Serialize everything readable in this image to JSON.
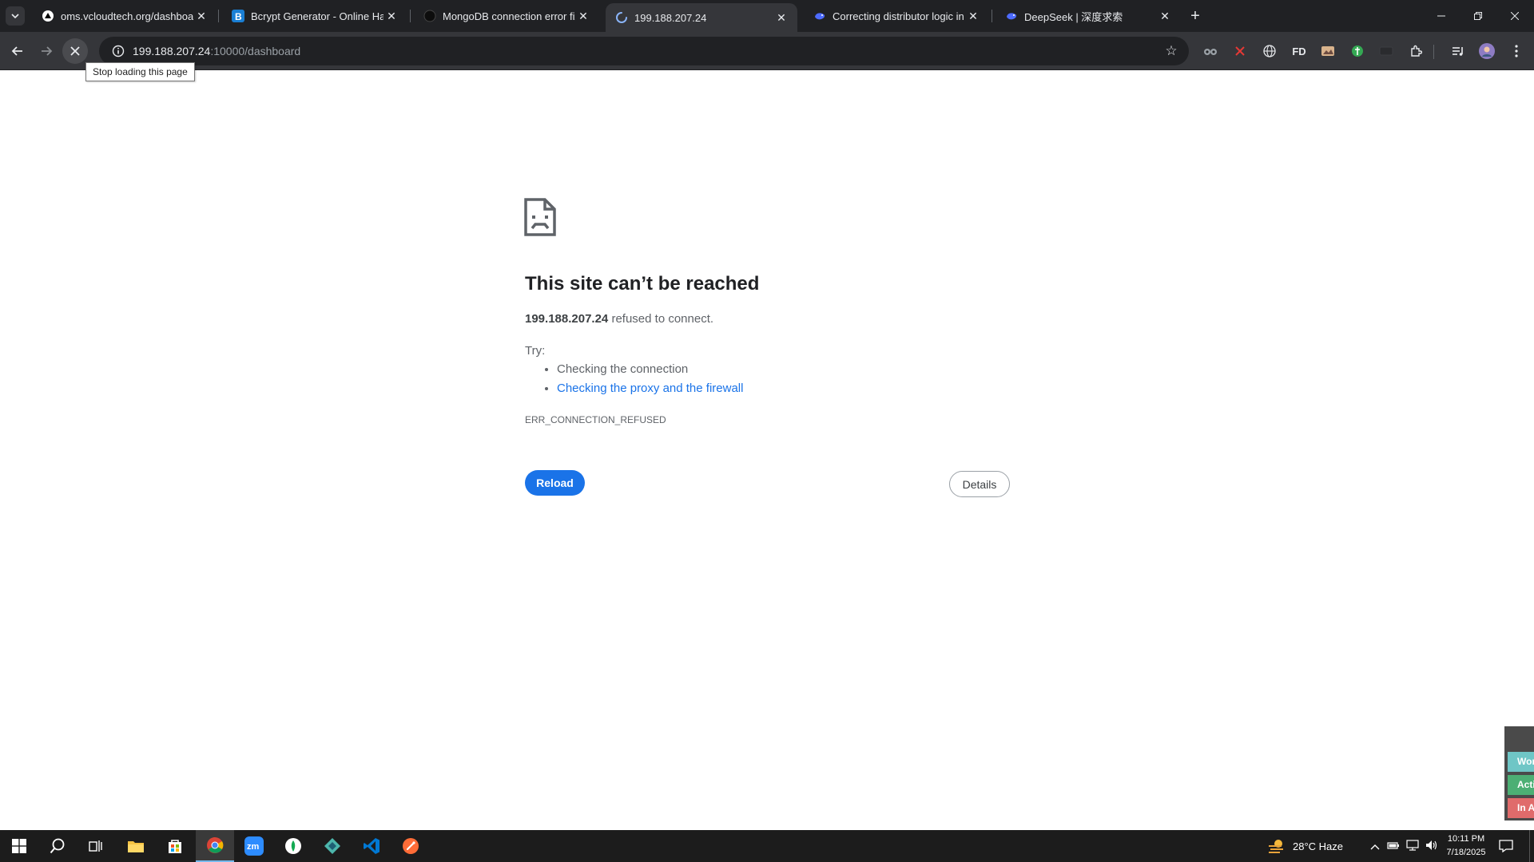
{
  "tabs": [
    {
      "title": "oms.vcloudtech.org/dashboard",
      "favicon": "triangle-logo-icon"
    },
    {
      "title": "Bcrypt Generator - Online Hash",
      "favicon": "bcrypt-b-icon"
    },
    {
      "title": "MongoDB connection error fix",
      "favicon": "openai-icon"
    },
    {
      "title": "199.188.207.24",
      "favicon": "loading-spinner-icon",
      "active": true
    },
    {
      "title": "Correcting distributor logic in Ja",
      "favicon": "deepseek-whale-icon"
    },
    {
      "title": "DeepSeek | 深度求索",
      "favicon": "deepseek-whale-icon"
    }
  ],
  "omnibox": {
    "host": "199.188.207.24",
    "path": ":10000/dashboard"
  },
  "tooltip": "Stop loading this page",
  "error": {
    "title": "This site can’t be reached",
    "host": "199.188.207.24",
    "message": " refused to connect.",
    "try_label": "Try:",
    "suggestions": [
      "Checking the connection",
      "Checking the proxy and the firewall"
    ],
    "code": "ERR_CONNECTION_REFUSED",
    "reload_label": "Reload",
    "details_label": "Details"
  },
  "extensions": {
    "fd_label": "FD"
  },
  "side_widget": [
    "Wor",
    "Acti",
    "In A"
  ],
  "taskbar": {
    "weather": "28°C  Haze",
    "time": "10:11 PM",
    "date": "7/18/2025"
  },
  "colors": {
    "accent": "#1a73e8",
    "tabstrip": "#202124",
    "toolbar": "#35363a"
  }
}
